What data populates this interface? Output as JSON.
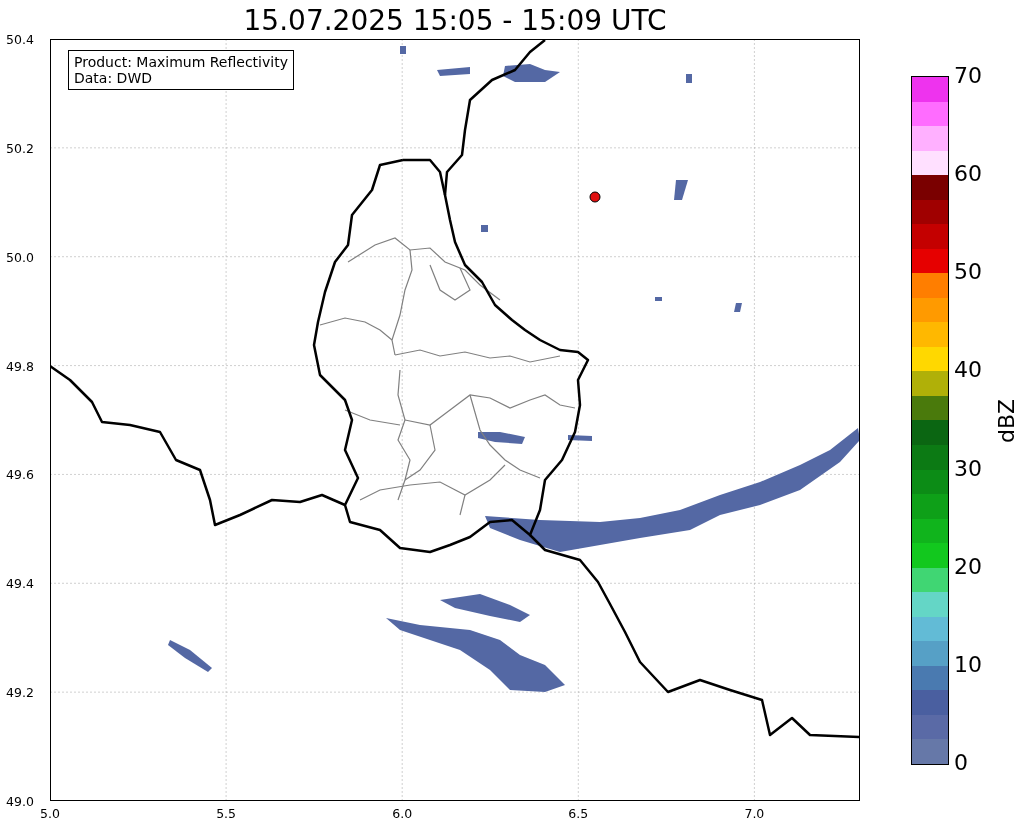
{
  "title": "15.07.2025 15:05 - 15:09 UTC",
  "info_box": [
    "Product: Maximum Reflectivity",
    "Data: DWD"
  ],
  "x_axis": {
    "ticks": [
      "5.0",
      "5.5",
      "6.0",
      "6.5",
      "7.0"
    ]
  },
  "y_axis": {
    "ticks": [
      "50.4",
      "50.2",
      "50.0",
      "49.8",
      "49.6",
      "49.4",
      "49.2",
      "49.0"
    ]
  },
  "colorbar": {
    "label": "dBZ",
    "ticks": [
      "70",
      "60",
      "50",
      "40",
      "30",
      "20",
      "10",
      "0"
    ],
    "steps": [
      {
        "color": "#ee33ee"
      },
      {
        "color": "#ff6cff"
      },
      {
        "color": "#ffb0ff"
      },
      {
        "color": "#ffe0ff"
      },
      {
        "color": "#7a0000"
      },
      {
        "color": "#a00000"
      },
      {
        "color": "#c40000"
      },
      {
        "color": "#e60000"
      },
      {
        "color": "#ff7e00"
      },
      {
        "color": "#ff9a00"
      },
      {
        "color": "#ffb800"
      },
      {
        "color": "#ffd800"
      },
      {
        "color": "#b0b008"
      },
      {
        "color": "#4a7a0c"
      },
      {
        "color": "#0b6612"
      },
      {
        "color": "#0c7a14"
      },
      {
        "color": "#0c8c16"
      },
      {
        "color": "#0ea018"
      },
      {
        "color": "#10b41c"
      },
      {
        "color": "#12c81e"
      },
      {
        "color": "#40d673"
      },
      {
        "color": "#64d6c6"
      },
      {
        "color": "#62bbd6"
      },
      {
        "color": "#56a0c6"
      },
      {
        "color": "#4a7ab0"
      },
      {
        "color": "#4a5fa0"
      },
      {
        "color": "#5a6aa6"
      },
      {
        "color": "#6678a8"
      }
    ]
  }
}
